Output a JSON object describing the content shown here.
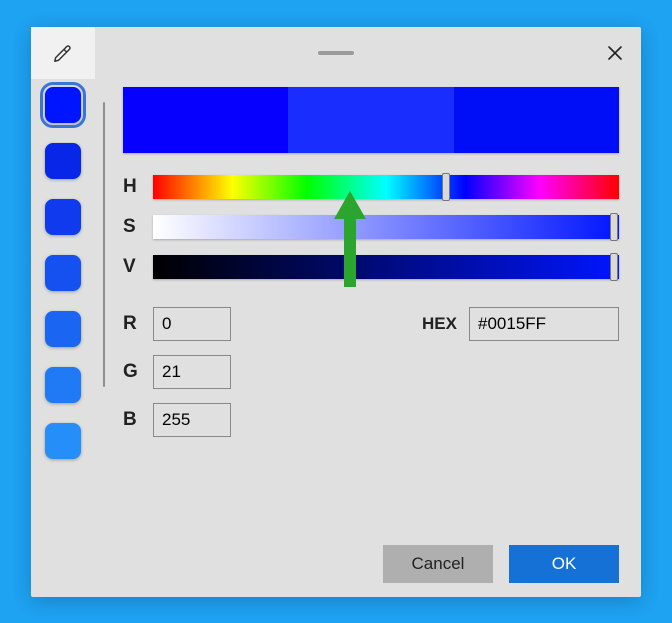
{
  "swatches": [
    {
      "color": "#0015FF",
      "selected": true
    },
    {
      "color": "#0726E8",
      "selected": false
    },
    {
      "color": "#0F3AED",
      "selected": false
    },
    {
      "color": "#1550F0",
      "selected": false
    },
    {
      "color": "#1B65F3",
      "selected": false
    },
    {
      "color": "#207AF5",
      "selected": false
    },
    {
      "color": "#268EF8",
      "selected": false
    }
  ],
  "preview": {
    "left": "#0600FF",
    "mid": "#1A2DFF",
    "right": "#000EF8"
  },
  "sliders": {
    "h": {
      "label": "H",
      "pos": 62
    },
    "s": {
      "label": "S",
      "pos": 98
    },
    "v": {
      "label": "V",
      "pos": 98
    }
  },
  "rgb": {
    "r": {
      "label": "R",
      "value": "0"
    },
    "g": {
      "label": "G",
      "value": "21"
    },
    "b": {
      "label": "B",
      "value": "255"
    }
  },
  "hex": {
    "label": "HEX",
    "value": "#0015FF"
  },
  "buttons": {
    "cancel": "Cancel",
    "ok": "OK"
  },
  "arrow_color": "#2BA52E"
}
